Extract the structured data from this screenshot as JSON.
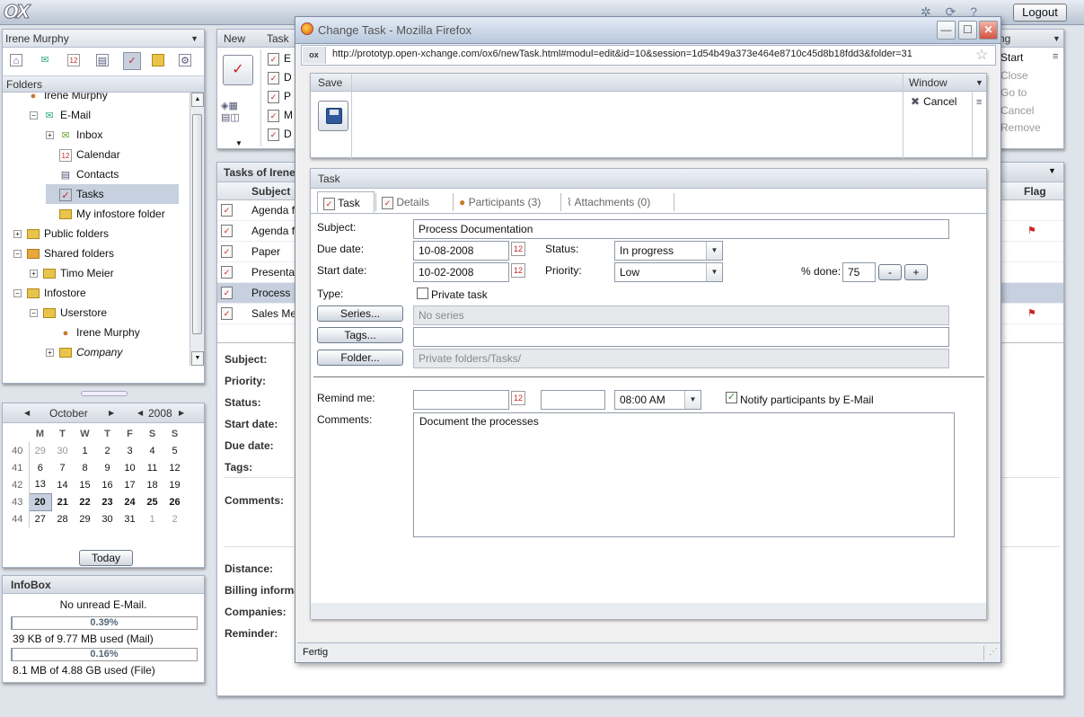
{
  "app": {
    "logo": "OX",
    "logout": "Logout",
    "user": "Irene Murphy",
    "folders_label": "Folders"
  },
  "tree": [
    {
      "label": "Irene Murphy",
      "icon": "user-icon",
      "level": 1,
      "pm": ""
    },
    {
      "label": "E-Mail",
      "icon": "mail-icon",
      "level": 2,
      "pm": "−"
    },
    {
      "label": "Inbox",
      "icon": "inbox-icon",
      "level": 3,
      "pm": "+"
    },
    {
      "label": "Calendar",
      "icon": "calendar-icon",
      "level": 3,
      "pm": ""
    },
    {
      "label": "Contacts",
      "icon": "contacts-icon",
      "level": 3,
      "pm": ""
    },
    {
      "label": "Tasks",
      "icon": "tasks-icon",
      "level": 3,
      "pm": "",
      "selected": true
    },
    {
      "label": "My infostore folder",
      "icon": "folder-icon",
      "level": 3,
      "pm": ""
    },
    {
      "label": "Public folders",
      "icon": "folder-icon",
      "level": 1,
      "pm": "+"
    },
    {
      "label": "Shared folders",
      "icon": "shared-folder-icon",
      "level": 1,
      "pm": "−"
    },
    {
      "label": "Timo Meier",
      "icon": "folder-icon",
      "level": 2,
      "pm": "+"
    },
    {
      "label": "Infostore",
      "icon": "folder-icon",
      "level": 1,
      "pm": "−"
    },
    {
      "label": "Userstore",
      "icon": "folder-icon",
      "level": 2,
      "pm": "−"
    },
    {
      "label": "Irene Murphy",
      "icon": "user-icon",
      "level": 3,
      "pm": ""
    },
    {
      "label": "Company",
      "icon": "folder-icon",
      "level": 3,
      "pm": "+",
      "italic": true
    }
  ],
  "calendar": {
    "month": "October",
    "year": "2008",
    "weekdays": [
      "M",
      "T",
      "W",
      "T",
      "F",
      "S",
      "S"
    ],
    "weeks": [
      {
        "wk": "40",
        "days": [
          "29",
          "30",
          "1",
          "2",
          "3",
          "4",
          "5"
        ]
      },
      {
        "wk": "41",
        "days": [
          "6",
          "7",
          "8",
          "9",
          "10",
          "11",
          "12"
        ]
      },
      {
        "wk": "42",
        "days": [
          "13",
          "14",
          "15",
          "16",
          "17",
          "18",
          "19"
        ]
      },
      {
        "wk": "43",
        "days": [
          "20",
          "21",
          "22",
          "23",
          "24",
          "25",
          "26"
        ]
      },
      {
        "wk": "44",
        "days": [
          "27",
          "28",
          "29",
          "30",
          "31",
          "1",
          "2"
        ]
      }
    ],
    "today_label": "Today"
  },
  "infobox": {
    "title": "InfoBox",
    "mail_status": "No unread E-Mail.",
    "mail_percent": "0.39%",
    "mail_fill": 0.0039,
    "mail_usage": "39 KB of 9.77 MB used (Mail)",
    "file_percent": "0.16%",
    "file_fill": 0.0016,
    "file_usage": "8.1 MB of 4.88 GB used (File)"
  },
  "toolbar": {
    "new": "New",
    "task_col": "Task",
    "right_col": "ng",
    "right_items": [
      "Start",
      "Close",
      "Go to",
      "Cancel",
      "Remove"
    ],
    "left_items": [
      "E",
      "D",
      "P",
      "M",
      "D"
    ]
  },
  "tasklist": {
    "title": "Tasks of Irene",
    "col_subject": "Subject",
    "col_flag": "Flag",
    "rows": [
      "Agenda f",
      "Agenda f",
      "Paper",
      "Presenta",
      "Process",
      "Sales Me"
    ]
  },
  "detail_labels": [
    "Subject:",
    "Priority:",
    "Status:",
    "Start date:",
    "Due date:",
    "Tags:",
    "Comments:",
    "Distance:",
    "Billing informa",
    "Companies:",
    "Reminder:"
  ],
  "firefox": {
    "title": "Change Task - Mozilla Firefox",
    "url": "http://prototyp.open-xchange.com/ox6/newTask.html#modul=edit&id=10&session=1d54b49a373e464e8710c45d8b18fdd3&folder=31",
    "url_badge": "ox",
    "status": "Fertig"
  },
  "dialog": {
    "save_label": "Save",
    "window_label": "Window",
    "cancel_label": "Cancel",
    "panel_title": "Task",
    "tabs": [
      "Task",
      "Details",
      "Participants (3)",
      "Attachments (0)"
    ],
    "subject_label": "Subject:",
    "subject": "Process Documentation",
    "due_label": "Due date:",
    "due": "10-08-2008",
    "start_label": "Start date:",
    "start": "10-02-2008",
    "status_label": "Status:",
    "status": "In progress",
    "priority_label": "Priority:",
    "priority": "Low",
    "percent_label": "% done:",
    "percent": "75",
    "type_label": "Type:",
    "private_label": "Private task",
    "private_checked": false,
    "series_btn": "Series...",
    "series_value": "No series",
    "tags_btn": "Tags...",
    "tags_value": "",
    "folder_btn": "Folder...",
    "folder_value": "Private folders/Tasks/",
    "remind_label": "Remind me:",
    "remind_date": "",
    "remind_time_text": "",
    "remind_time": "08:00 AM",
    "notify_label": "Notify participants by E-Mail",
    "notify_checked": true,
    "comments_label": "Comments:",
    "comments": "Document the processes",
    "minus": "-",
    "plus": "+"
  },
  "colors": {
    "accent": "#d2dbe8",
    "selected": "#c7d0df",
    "flag": "#cc2222"
  }
}
